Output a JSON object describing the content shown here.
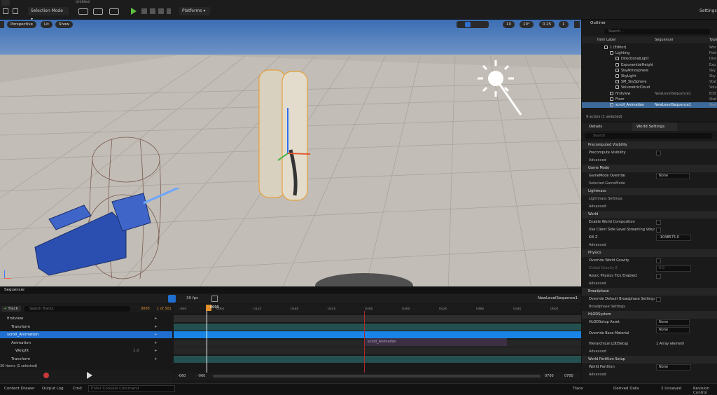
{
  "toolbar": {
    "tab_label": "Untitled",
    "selection_mode": "Selection Mode",
    "platforms": "Platforms",
    "settings": "Settings"
  },
  "viewport": {
    "perspective": "Perspective",
    "lit": "Lit",
    "show": "Show",
    "grid_snap": "10",
    "rot_snap": "10°",
    "scale_snap": "0.25",
    "cam_speed": "1"
  },
  "outliner": {
    "title": "Outliner",
    "search_placeholder": "Search...",
    "col_label": "Item Label",
    "col_sequencer": "Sequencer",
    "col_type": "Type",
    "items": [
      {
        "label": "1 (Editor)",
        "seq": "",
        "type": "Wor"
      },
      {
        "label": "Lighting",
        "seq": "",
        "type": "Fold"
      },
      {
        "label": "DirectionalLight",
        "seq": "",
        "type": "Dire"
      },
      {
        "label": "ExponentialHeightFo",
        "seq": "",
        "type": "Exp"
      },
      {
        "label": "SkyAtmosphere",
        "seq": "",
        "type": "Sky"
      },
      {
        "label": "SkyLight",
        "seq": "",
        "type": "Sky"
      },
      {
        "label": "SM_SkySphere",
        "seq": "",
        "type": "Stat"
      },
      {
        "label": "VolumetricCloud",
        "seq": "",
        "type": "Volu"
      },
      {
        "label": "firstview",
        "seq": "NewLevelSequence1",
        "type": "Edit"
      },
      {
        "label": "Floor",
        "seq": "",
        "type": "Stat"
      },
      {
        "label": "scroll_Animation",
        "seq": "NewLevelSequence1",
        "type": "Skel"
      }
    ],
    "count": "9 actors (1 selected)"
  },
  "details": {
    "tab_details": "Details",
    "tab_world": "World Settings",
    "search_placeholder": "Search",
    "rows": [
      {
        "kind": "sec",
        "label": "Precomputed Visibility"
      },
      {
        "kind": "prop",
        "label": "Precompute Visibility",
        "ctl": "cb"
      },
      {
        "kind": "sub",
        "label": "Advanced"
      },
      {
        "kind": "sec",
        "label": "Game Mode"
      },
      {
        "kind": "prop",
        "label": "GameMode Override",
        "ctl": "dd",
        "value": "None"
      },
      {
        "kind": "sub",
        "label": "Selected GameMode"
      },
      {
        "kind": "sec",
        "label": "Lightmass"
      },
      {
        "kind": "sub",
        "label": "Lightmass Settings"
      },
      {
        "kind": "sub",
        "label": "Advanced"
      },
      {
        "kind": "sec",
        "label": "World"
      },
      {
        "kind": "prop",
        "label": "Enable World Composition",
        "ctl": "cb"
      },
      {
        "kind": "prop",
        "label": "Use Client Side Level Streaming Volumes",
        "ctl": "cb"
      },
      {
        "kind": "prop",
        "label": "Kill Z",
        "ctl": "fld",
        "value": "-1048575.0"
      },
      {
        "kind": "sub",
        "label": "Advanced"
      },
      {
        "kind": "sec",
        "label": "Physics"
      },
      {
        "kind": "prop",
        "label": "Override World Gravity",
        "ctl": "cb"
      },
      {
        "kind": "prop",
        "label": "Global Gravity Z",
        "ctl": "fld",
        "value": "0.0",
        "dim": true
      },
      {
        "kind": "prop",
        "label": "Async Physics Tick Enabled",
        "ctl": "cb"
      },
      {
        "kind": "sub",
        "label": "Advanced"
      },
      {
        "kind": "sec",
        "label": "Broadphase"
      },
      {
        "kind": "prop",
        "label": "Override Default Broadphase Settings",
        "ctl": "cb"
      },
      {
        "kind": "sub",
        "label": "Broadphase Settings"
      },
      {
        "kind": "sec",
        "label": "HLODSystem"
      },
      {
        "kind": "prop",
        "label": "HLODSetup Asset",
        "ctl": "dd",
        "value": "None"
      },
      {
        "kind": "prop2",
        "label": "Override Base Material",
        "ctl": "dd",
        "value": "None"
      },
      {
        "kind": "prop",
        "label": "Hierarchical LODSetup",
        "ctl": "txt",
        "value": "1 Array element"
      },
      {
        "kind": "sub",
        "label": "Advanced"
      },
      {
        "kind": "sec",
        "label": "World Partition Setup"
      },
      {
        "kind": "prop",
        "label": "World Partition",
        "ctl": "fld",
        "value": "None"
      },
      {
        "kind": "sub",
        "label": "Advanced"
      }
    ]
  },
  "sequencer": {
    "tab": "Sequencer",
    "fps": "30 fps",
    "track_btn": "Track",
    "search_placeholder": "Search Tracks",
    "frame": "0000",
    "frame_total": "1 of 301",
    "seq_name": "NewLevelSequence1",
    "playhead": "0000",
    "ticks": [
      "-060",
      "0060",
      "0120",
      "0180",
      "0240",
      "0300",
      "0360",
      "0420",
      "0480",
      "0540",
      "0600"
    ],
    "tracks": [
      {
        "label": "firstview",
        "indent": 0,
        "sel": false
      },
      {
        "label": "Transform",
        "indent": 1,
        "sel": false
      },
      {
        "label": "scroll_Animation",
        "indent": 0,
        "sel": true
      },
      {
        "label": "Animation",
        "indent": 1,
        "sel": false
      },
      {
        "label": "Weight",
        "indent": 2,
        "sel": false,
        "value": "1.0"
      },
      {
        "label": "Transform",
        "indent": 1,
        "sel": false
      }
    ],
    "clip_label": "scroll_Animation",
    "items_count": "30 items (1 selected)",
    "range_start": "-060",
    "range_start2": "-060",
    "range_end": "0700",
    "range_end2": "0700"
  },
  "status": {
    "content_drawer": "Content Drawer",
    "output_log": "Output Log",
    "cmd": "Cmd",
    "cmd_placeholder": "Enter Console Command",
    "trace": "Trace",
    "derived": "Derived Data",
    "unsaved": "2 Unsaved",
    "revision": "Revision Control"
  }
}
